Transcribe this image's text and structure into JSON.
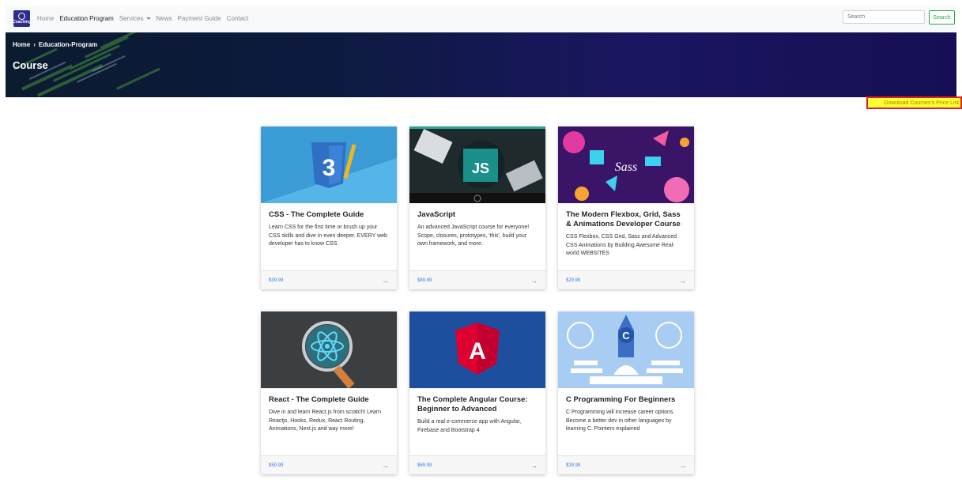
{
  "navbar": {
    "logo_text": "Coaching",
    "links": [
      {
        "label": "Home"
      },
      {
        "label": "Education Program"
      },
      {
        "label": "Services"
      },
      {
        "label": "News"
      },
      {
        "label": "Payment Guide"
      },
      {
        "label": "Contact"
      }
    ],
    "search": {
      "placeholder": "Search",
      "button_label": "Search"
    }
  },
  "banner": {
    "breadcrumb": [
      "Home",
      "Education-Program"
    ],
    "title": "Course"
  },
  "download_link": "Download Courses's Price List",
  "colors": {
    "accent": "#3b7ddd",
    "success": "#28a745",
    "highlight": "#ffff33",
    "highlight_border": "#e0202a"
  },
  "courses": [
    {
      "title": "CSS - The Complete Guide",
      "description": "Learn CSS for the first time or brush up your CSS skills and dive in even deeper. EVERY web developer has to know CSS.",
      "price": "$39.99",
      "image_label": "3"
    },
    {
      "title": "JavaScript",
      "description": "An advanced JavaScript course for everyone! Scope, closures, prototypes, 'this', build your own framework, and more.",
      "price": "$89.99",
      "image_label": "JS"
    },
    {
      "title": "The Modern Flexbox, Grid, Sass & Animations Developer Course",
      "description": "CSS Flexbox, CSS Grid, Sass and Advanced CSS Animations by Building Awesome Real-world WEBSITES",
      "price": "$29.99",
      "image_label": "Sass"
    },
    {
      "title": "React - The Complete Guide",
      "description": "Dive in and learn React.js from scratch! Learn Reactjs, Hooks, Redux, React Routing, Animations, Next.js and way more!",
      "price": "$59.99",
      "image_label": ""
    },
    {
      "title": "The Complete Angular Course: Beginner to Advanced",
      "description": "Build a real e-commerce app with Angular, Firebase and Bootstrap 4",
      "price": "$69.99",
      "image_label": "A"
    },
    {
      "title": "C Programming For Beginners",
      "description": "C Programming will increase career options. Become a better dev in other languages by learning C. Pointers explained",
      "price": "$39.99",
      "image_label": "C"
    }
  ]
}
